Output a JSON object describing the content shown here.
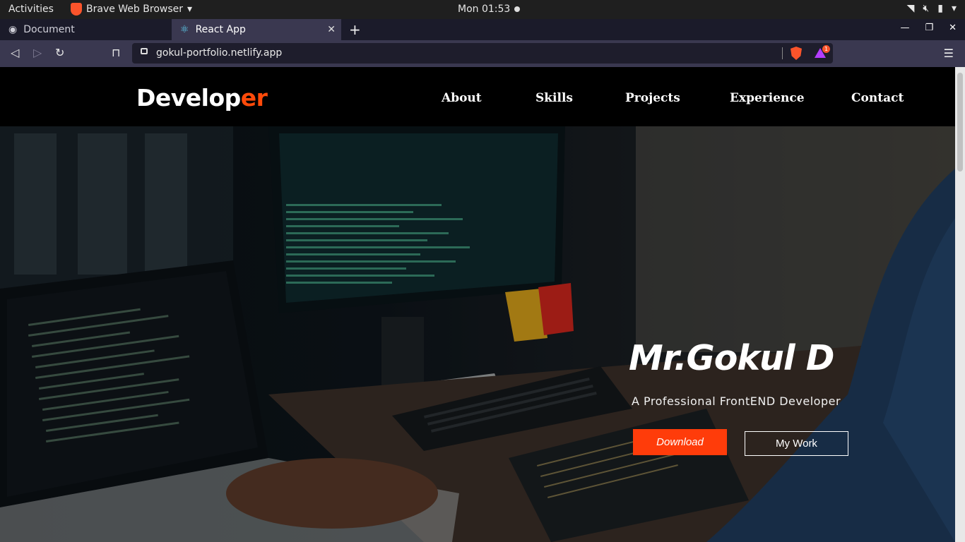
{
  "system_bar": {
    "activities": "Activities",
    "app_name": "Brave Web Browser",
    "clock": "Mon 01:53"
  },
  "tabs": [
    {
      "title": "Document",
      "active": false
    },
    {
      "title": "React App",
      "active": true
    }
  ],
  "address_bar": {
    "url": "gokul-portfolio.netlify.app",
    "rewards_badge": "1"
  },
  "site": {
    "logo_main": "Develop",
    "logo_accent": "er",
    "nav": [
      "About",
      "Skills",
      "Projects",
      "Experience",
      "Contact"
    ]
  },
  "hero": {
    "name": "Mr.Gokul D",
    "subtitle": "A Professional FrontEND Developer",
    "download_label": "Download",
    "work_label": "My Work"
  },
  "colors": {
    "accent": "#ff4a0a",
    "browser_chrome": "#3a3850",
    "nav_bg": "#000000"
  }
}
